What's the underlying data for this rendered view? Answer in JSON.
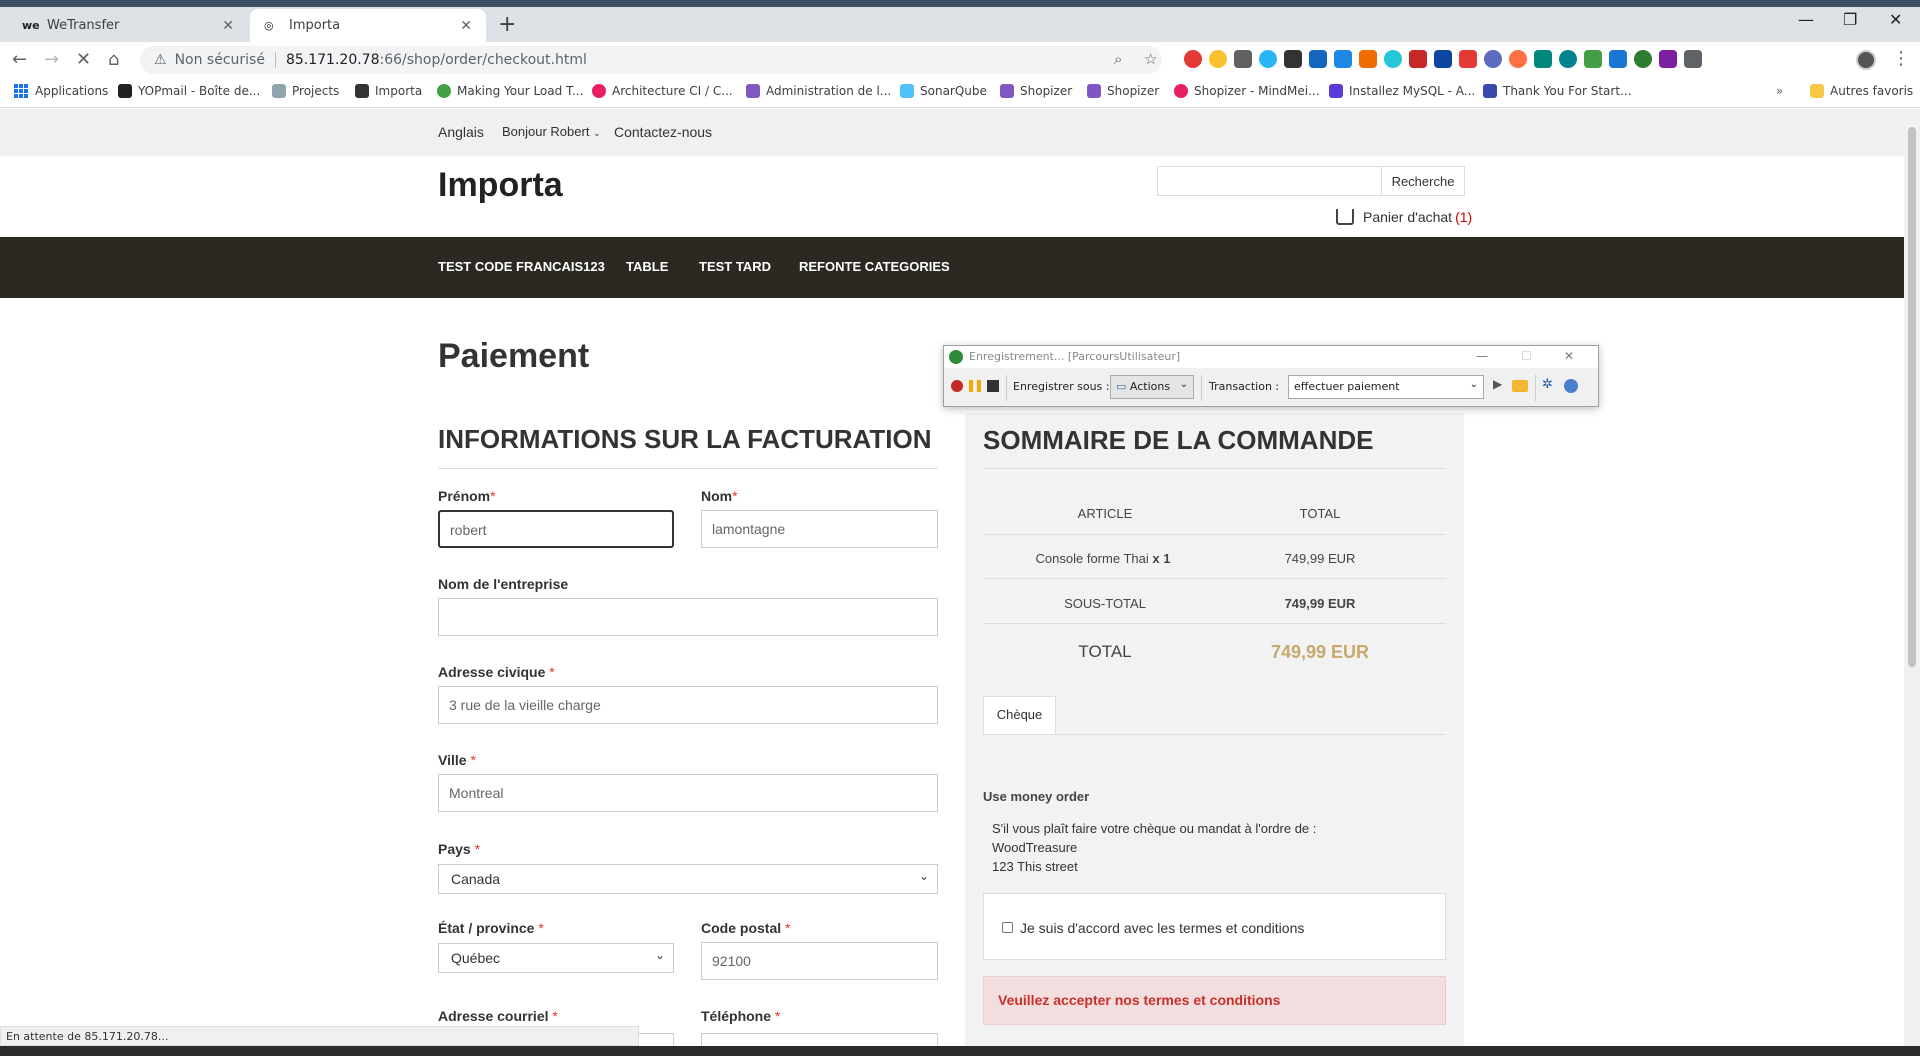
{
  "browser": {
    "tabs": [
      {
        "label": "WeTransfer",
        "favicon": "we"
      },
      {
        "label": "Importa",
        "favicon": "globe-icon"
      }
    ],
    "address": {
      "security": "Non sécurisé",
      "host": "85.171.20.78",
      "path": ":66/shop/order/checkout.html"
    },
    "bookmarks": [
      "Applications",
      "YOPmail - Boîte de...",
      "Projects",
      "Importa",
      "Making Your Load T...",
      "Architecture CI / C...",
      "Administration de l...",
      "SonarQube",
      "Shopizer",
      "Shopizer",
      "Shopizer - MindMei...",
      "Installez MySQL - A...",
      "Thank You For Start...",
      "Autres favoris"
    ],
    "status": "En attente de 85.171.20.78..."
  },
  "shop": {
    "topbar": {
      "language": "Anglais",
      "greeting": "Bonjour Robert",
      "contact": "Contactez-nous"
    },
    "brand": "Importa",
    "search": {
      "button": "Recherche",
      "value": ""
    },
    "cart": {
      "label": "Panier d'achat",
      "count": "(1)"
    },
    "nav": [
      "TEST CODE FRANCAIS123",
      "TABLE",
      "TEST TARD",
      "REFONTE CATEGORIES"
    ]
  },
  "checkout": {
    "page_title": "Paiement",
    "billing_title": "INFORMATIONS SUR LA FACTURATION",
    "required_mark": "*",
    "fields": {
      "first_name": {
        "label": "Prénom",
        "value": "robert"
      },
      "last_name": {
        "label": "Nom",
        "value": "lamontagne"
      },
      "company": {
        "label": "Nom de l'entreprise",
        "value": ""
      },
      "address": {
        "label": "Adresse civique",
        "value": "3 rue de la vieille charge"
      },
      "city": {
        "label": "Ville",
        "value": "Montreal"
      },
      "country": {
        "label": "Pays",
        "value": "Canada"
      },
      "state": {
        "label": "État / province",
        "value": "Québec"
      },
      "postal": {
        "label": "Code postal",
        "value": "92100"
      },
      "email": {
        "label": "Adresse courriel"
      },
      "phone": {
        "label": "Téléphone"
      }
    }
  },
  "summary": {
    "title": "SOMMAIRE DE LA COMMANDE",
    "col_article": "ARTICLE",
    "col_total": "TOTAL",
    "item_name": "Console forme Thai",
    "item_qty": "x 1",
    "item_price": "749,99 EUR",
    "subtotal_label": "SOUS-TOTAL",
    "subtotal_value": "749,99 EUR",
    "total_label": "TOTAL",
    "total_value": "749,99 EUR",
    "payment_tab": "Chèque",
    "payment_heading": "Use money order",
    "payment_line1": "S'il vous plaît faire votre chèque ou mandat à l'ordre de :",
    "payment_line2": "WoodTreasure",
    "payment_line3": "123 This street",
    "terms_label": "Je suis d'accord avec les termes et conditions",
    "alert": "Veuillez accepter nos termes et conditions"
  },
  "recorder": {
    "title": "Enregistrement... [ParcoursUtilisateur]",
    "save_as_label": "Enregistrer sous :",
    "save_as_value": "Actions",
    "transaction_label": "Transaction :",
    "transaction_value": "effectuer paiement"
  },
  "colors": {
    "navbar": "#2b2921",
    "total_price": "#c8a96e",
    "alert_bg": "#f2dede",
    "alert_text": "#c9302c"
  }
}
